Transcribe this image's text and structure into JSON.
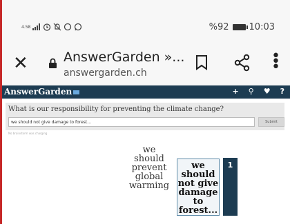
{
  "status_bar": {
    "signal": "4.58",
    "battery": "%92",
    "time": "10:03"
  },
  "browser": {
    "page_title": "AnswerGarden »...",
    "url": "answergarden.ch"
  },
  "site": {
    "logo": "AnswerGarden",
    "header_icons": [
      "+",
      "search-icon",
      "heart-icon",
      "?"
    ]
  },
  "form": {
    "question": "What is our responsibility for preventing the climate change?",
    "answer_value": "we should not give damage to forest...",
    "submit_label": "Submit",
    "note": "No brainstorm was charging"
  },
  "cloud": {
    "words": [
      {
        "lines": [
          "we",
          "should",
          "prevent",
          "global",
          "warming"
        ]
      }
    ],
    "selected": {
      "lines": [
        "we",
        "should",
        "not give",
        "damage",
        "to",
        "forest..."
      ],
      "count": "1"
    }
  },
  "colors": {
    "header": "#1d3c52",
    "edge": "#c62828"
  }
}
